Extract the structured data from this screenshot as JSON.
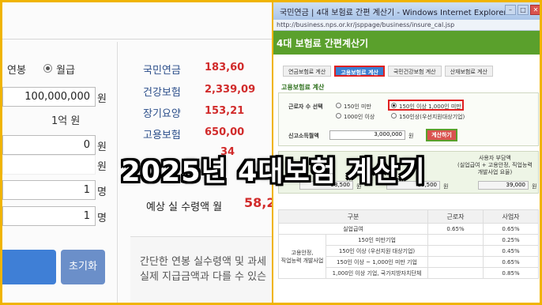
{
  "left": {
    "annual_label": "연봉",
    "monthly_label": "월급",
    "salary_value": "100,000,000",
    "won_unit": "원",
    "salary_hint": "1억 원",
    "row3_value": "0",
    "row4_unit": "원",
    "row5_value": "1",
    "person_unit": "명",
    "row6_value": "1",
    "reset_label": "초기화",
    "insurance": [
      {
        "name": "국민연금",
        "value": "183,60"
      },
      {
        "name": "건강보험",
        "value": "2,339,09"
      },
      {
        "name": "장기요양",
        "value": "153,21"
      },
      {
        "name": "고용보험",
        "value": "650,00"
      }
    ],
    "partial_value": "34",
    "net_pay_label": "예상 실 수령액  월",
    "net_pay_value": "58,2",
    "desc_line1": "간단한 연봉 실수령액 및 과세",
    "desc_line2": "실제 지급금액과 다를 수 있슨"
  },
  "window": {
    "title": "국민연금 | 4대 보험료 간편 계산기 - Windows Internet Explorer",
    "url": "http://business.nps.or.kr/jsppage/business/insure_cal.jsp",
    "app_title": "4대 보험료 간편계산기",
    "tabs": [
      "연금보험료 계산",
      "고용보험료 계산",
      "국민건강보험 계산",
      "산재보험료 계산"
    ],
    "section_title": "고용보험료 계산",
    "worker_label": "근로자 수 선택",
    "options": [
      "150인 미만",
      "150인 이상 1,000인 미만",
      "1000인 이상",
      "150인상(우선지원대상기업)"
    ],
    "income_label": "신고소득월액",
    "income_value": "3,000,000",
    "calc_button": "계산하기",
    "result_header": "사용자 부담액\n(실업급여 + 고용안정, 직업능력\n개발사업 요율)",
    "result_left": "58,500",
    "result_mid": "19,500",
    "result_right": "39,000",
    "won": "원",
    "table_headers": [
      "구분",
      "근로자",
      "사업자"
    ],
    "table_rows": [
      [
        "실업급여",
        "0.65%",
        "0.65%"
      ],
      [
        "150인 미만기업",
        "",
        "0.25%"
      ],
      [
        "150인 이상 (우선지원 대상기업)",
        "",
        "0.45%"
      ],
      [
        "150인 이상 ~ 1,000인 미만 기업",
        "",
        "0.65%"
      ],
      [
        "1,000인 이상 기업, 국가지방자치단체",
        "",
        "0.85%"
      ]
    ],
    "group_label": "고용안정,\n직업능력 개발사업"
  },
  "headline": "2025년 4대보험 계산기"
}
